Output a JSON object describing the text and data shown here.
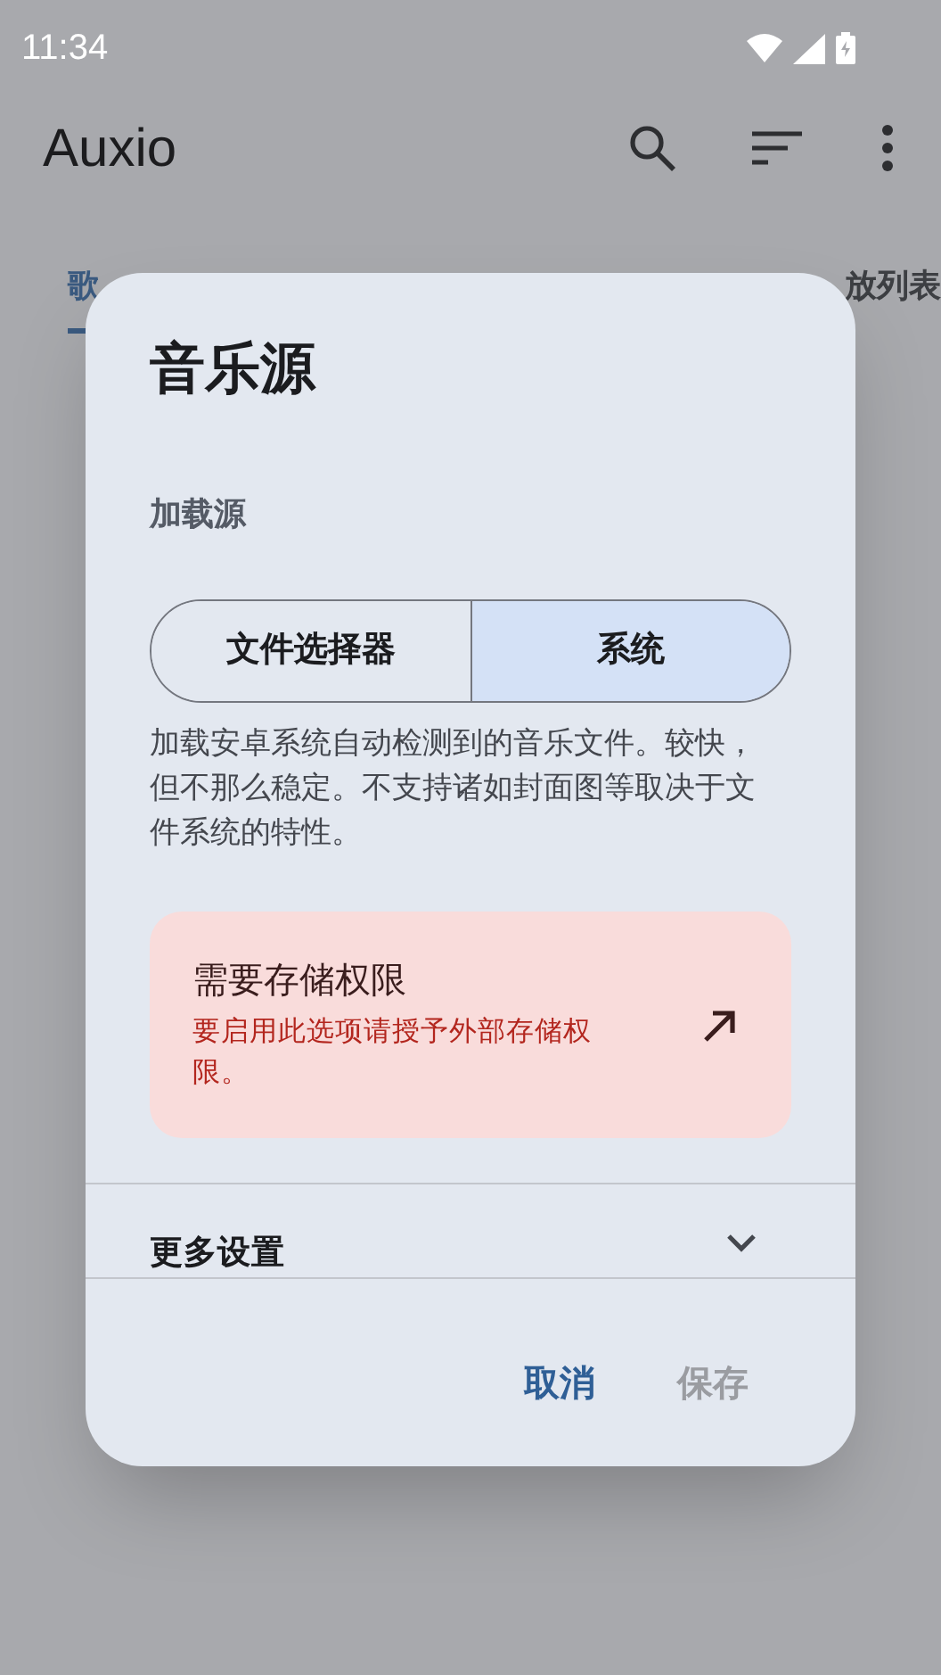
{
  "status_bar": {
    "time": "11:34"
  },
  "app_bar": {
    "title": "Auxio"
  },
  "tabs": [
    {
      "label": "歌",
      "selected": true
    },
    {
      "label": "放列表",
      "selected": false
    }
  ],
  "dialog": {
    "title": "音乐源",
    "section_label": "加载源",
    "options": [
      {
        "label": "文件选择器",
        "selected": false
      },
      {
        "label": "系统",
        "selected": true
      }
    ],
    "description": "加载安卓系统自动检测到的音乐文件。较快，但不那么稳定。不支持诸如封面图等取决于文件系统的特性。",
    "permission_card": {
      "title": "需要存储权限",
      "message": "要启用此选项请授予外部存储权限。"
    },
    "more_settings": {
      "label": "更多设置",
      "expanded": false
    },
    "buttons": [
      {
        "label": "取消",
        "disabled": false
      },
      {
        "label": "保存",
        "disabled": true
      }
    ]
  }
}
